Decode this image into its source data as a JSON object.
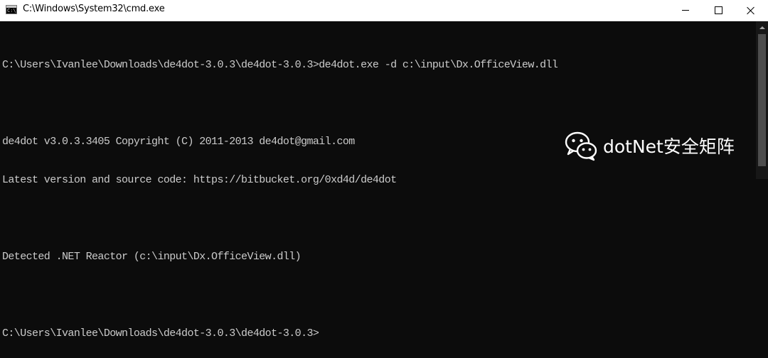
{
  "window": {
    "title": "C:\\Windows\\System32\\cmd.exe",
    "icon": "cmd-app-icon",
    "controls": [
      "minimize",
      "maximize",
      "close"
    ]
  },
  "console": {
    "lines": [
      "",
      "C:\\Users\\Ivanlee\\Downloads\\de4dot-3.0.3\\de4dot-3.0.3>de4dot.exe -d c:\\input\\Dx.OfficeView.dll",
      "",
      "de4dot v3.0.3.3405 Copyright (C) 2011-2013 de4dot@gmail.com",
      "Latest version and source code: https://bitbucket.org/0xd4d/de4dot",
      "",
      "Detected .NET Reactor (c:\\input\\Dx.OfficeView.dll)",
      "",
      "C:\\Users\\Ivanlee\\Downloads\\de4dot-3.0.3\\de4dot-3.0.3>"
    ]
  },
  "watermark": {
    "text": "dotNet安全矩阵",
    "icon": "wechat-icon"
  },
  "colors": {
    "console_bg": "#0c0c0c",
    "console_fg": "#cccccc",
    "titlebar_bg": "#ffffff"
  }
}
